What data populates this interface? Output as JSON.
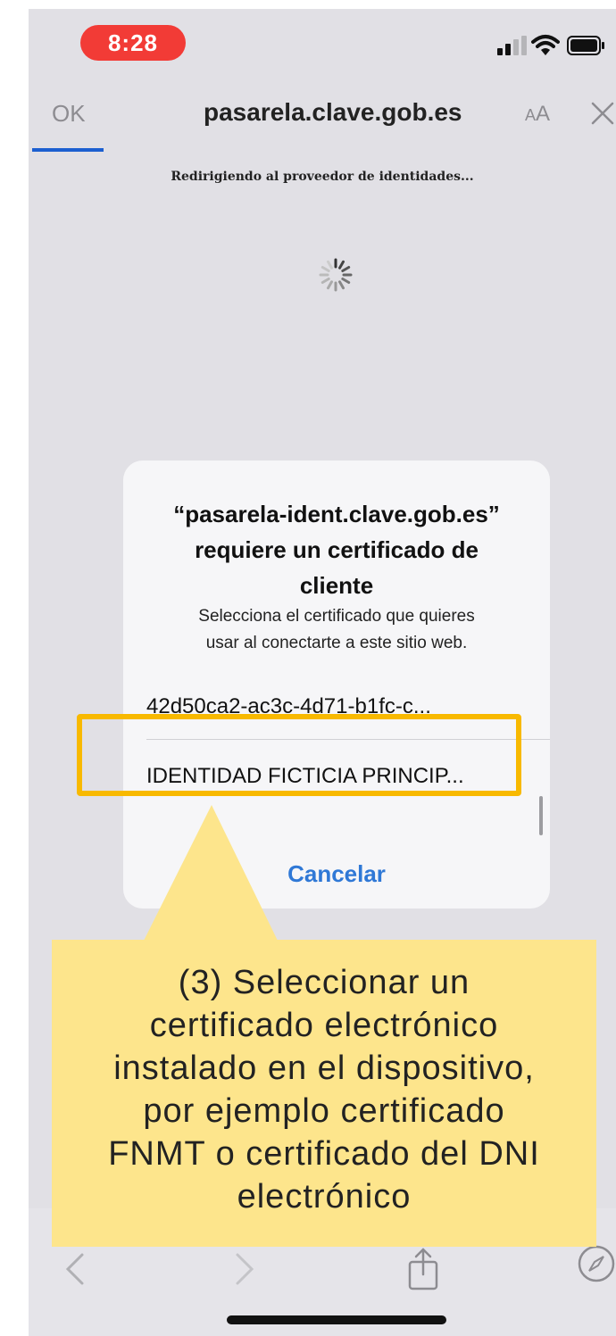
{
  "status_bar": {
    "time": "8:28"
  },
  "nav": {
    "done_label": "OK",
    "url": "pasarela.clave.gob.es",
    "text_size_label": "AA"
  },
  "page": {
    "redirect_text": "Redirigiendo al proveedor de identidades..."
  },
  "dialog": {
    "title_line1": "“pasarela-ident.clave.gob.es”",
    "title_line2": "requiere un certificado de",
    "title_line3": "cliente",
    "message_line1": "Selecciona el certificado que quieres",
    "message_line2": "usar al conectarte a este sitio web.",
    "certificates": [
      {
        "label": "42d50ca2-ac3c-4d71-b1fc-c..."
      },
      {
        "label": "IDENTIDAD FICTICIA PRINCIP..."
      }
    ],
    "cancel_label": "Cancelar"
  },
  "callout": {
    "line1": "(3) Seleccionar un",
    "line2": "certificado electrónico",
    "line3": "instalado en el dispositivo,",
    "line4": "por ejemplo certificado",
    "line5": "FNMT o certificado del DNI",
    "line6": "electrónico"
  },
  "colors": {
    "highlight": "#f8b900",
    "callout_bg": "#fde58c",
    "link_blue": "#2f78d6",
    "time_pill": "#f23b36"
  },
  "icons": [
    "signal-icon",
    "wifi-icon",
    "battery-icon",
    "close-icon",
    "spinner-icon",
    "back-icon",
    "forward-icon",
    "share-icon",
    "safari-icon"
  ]
}
